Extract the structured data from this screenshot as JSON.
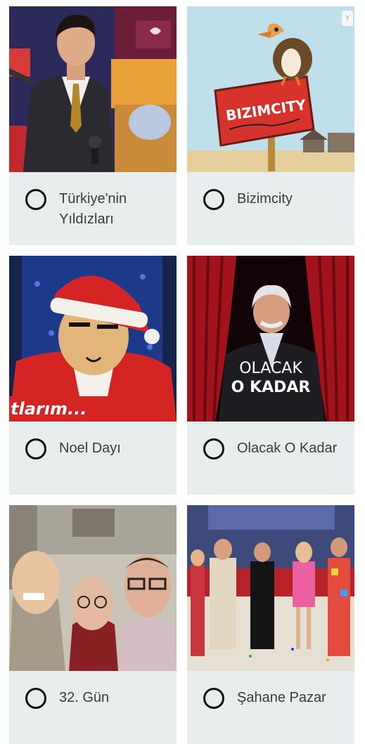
{
  "options": [
    {
      "label": "Türkiye'nin Yıldızları",
      "image": "studio-host-with-microphone"
    },
    {
      "label": "Bizimcity",
      "image": "cartoon-vulture-on-sign"
    },
    {
      "label": "Noel Dayı",
      "image": "cartoon-santa-character"
    },
    {
      "label": "Olacak O Kadar",
      "image": "presenter-red-curtain"
    },
    {
      "label": "32. Gün",
      "image": "puppet-caricatures"
    },
    {
      "label": "Şahane Pazar",
      "image": "tv-show-stage"
    }
  ],
  "artwork_text": {
    "bizimcity_sign": "BIZIMCITY",
    "noel_banner": "tlarım...",
    "olacak_line1": "OLACAK",
    "olacak_line2": "O KADAR"
  },
  "corner_badge_icon": "y-badge-icon"
}
